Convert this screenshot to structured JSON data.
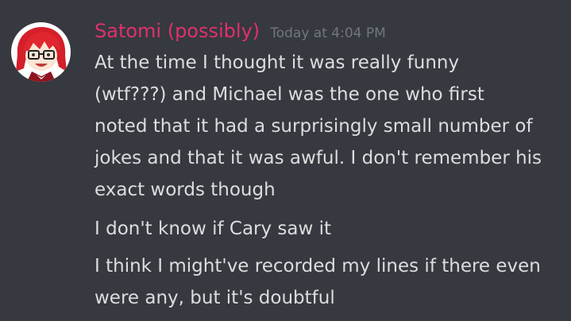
{
  "message": {
    "author": "Satomi (possibly)",
    "timestamp": "Today at 4:04 PM",
    "avatar_icon": "user-avatar",
    "author_color": "#e0306d",
    "paragraphs": [
      {
        "lines": [
          "At the time I thought it was really funny",
          "(wtf???) and Michael was the one who first",
          "noted that it had a surprisingly small number of",
          "jokes and that it was awful. I don't remember his",
          "exact words though"
        ]
      },
      {
        "lines": [
          "I don't know if Cary saw it"
        ]
      },
      {
        "lines": [
          "I think I might've recorded my lines if there even",
          "were any, but it's doubtful"
        ]
      }
    ]
  },
  "theme": {
    "background": "#36393f",
    "text": "#dcddde",
    "muted": "#72767d"
  }
}
